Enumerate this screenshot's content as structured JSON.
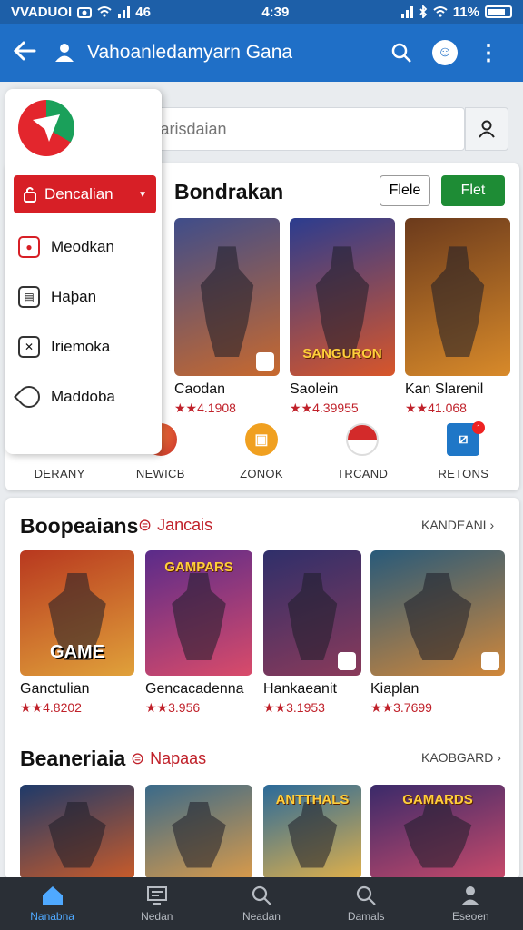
{
  "status_bar": {
    "left_text": "VVADUOI",
    "time_small": "46",
    "time": "4:39",
    "battery_text": "11%"
  },
  "app_bar": {
    "title": "Vahoanledamyarn Gana"
  },
  "drawer": {
    "dropdown_label": "Dencalian",
    "items": [
      {
        "label": "Meodkan",
        "icon": "record-icon"
      },
      {
        "label": "Haþan",
        "icon": "image-icon"
      },
      {
        "label": "Iriemoka",
        "icon": "star-frame-icon"
      },
      {
        "label": "Maddoba",
        "icon": "tag-icon"
      }
    ]
  },
  "search": {
    "placeholder": "Uacarisdaian"
  },
  "featured": {
    "title": "Bondrakan",
    "btn_white": "Flele",
    "btn_green": "Flet",
    "games": [
      {
        "name": "Caodan",
        "rating": "★★4.1908",
        "colors": [
          "#3f4d8a",
          "#c8692e"
        ]
      },
      {
        "name": "Saolein",
        "rating": "★★4.39955",
        "colors": [
          "#2b3c8f",
          "#d8562a"
        ],
        "banner": "SANGURON"
      },
      {
        "name": "Kan Slarenil",
        "rating": "★★41.068",
        "colors": [
          "#6b3a1c",
          "#d88a2a"
        ]
      }
    ]
  },
  "quick_nav": [
    {
      "label": "DERANY",
      "icon": "home-icon",
      "color": "#1f6fc7"
    },
    {
      "label": "NEWICB",
      "icon": "ball-icon",
      "color": "#e2502a"
    },
    {
      "label": "ZONOK",
      "icon": "coin-icon",
      "color": "#f0a020"
    },
    {
      "label": "TRCAND",
      "icon": "pokeball-icon",
      "color": "#d32a2a"
    },
    {
      "label": "RETONS",
      "icon": "box-icon",
      "color": "#1f77c7",
      "badge": "1"
    }
  ],
  "section2": {
    "title": "Boopeaians",
    "subtitle": "Jancais",
    "more": "KANDEANI",
    "games": [
      {
        "name": "Ganctulian",
        "rating": "★★4.8202",
        "colors": [
          "#b8381f",
          "#e0a13a"
        ],
        "word": "GAME"
      },
      {
        "name": "Gencacadenna",
        "rating": "★★3.956",
        "colors": [
          "#5a2b8a",
          "#d94b6a"
        ],
        "banner": "GAMPARS"
      },
      {
        "name": "Hankaeanit",
        "rating": "★★3.1953",
        "colors": [
          "#2f2f6a",
          "#8a3a5a"
        ]
      },
      {
        "name": "Kiaplan",
        "rating": "★★3.7699",
        "colors": [
          "#285a7a",
          "#d0873a"
        ]
      }
    ]
  },
  "section3": {
    "title": "Beaneriaia",
    "subtitle": "Napaas",
    "more": "KAOBGARD",
    "games": [
      {
        "colors": [
          "#1e3a6a",
          "#c85b2a"
        ]
      },
      {
        "colors": [
          "#3a6a8a",
          "#d89a4a"
        ]
      },
      {
        "colors": [
          "#2a6a9a",
          "#e0b04a"
        ],
        "banner": "ANTTHALS"
      },
      {
        "colors": [
          "#3a2a6a",
          "#c84a6a"
        ],
        "banner": "GAMARDS"
      }
    ]
  },
  "bottom_nav": [
    {
      "label": "Nanabna",
      "icon": "home-icon"
    },
    {
      "label": "Nedan",
      "icon": "news-icon"
    },
    {
      "label": "Neadan",
      "icon": "search-icon"
    },
    {
      "label": "Damals",
      "icon": "search-icon"
    },
    {
      "label": "Eseoen",
      "icon": "user-icon"
    }
  ]
}
